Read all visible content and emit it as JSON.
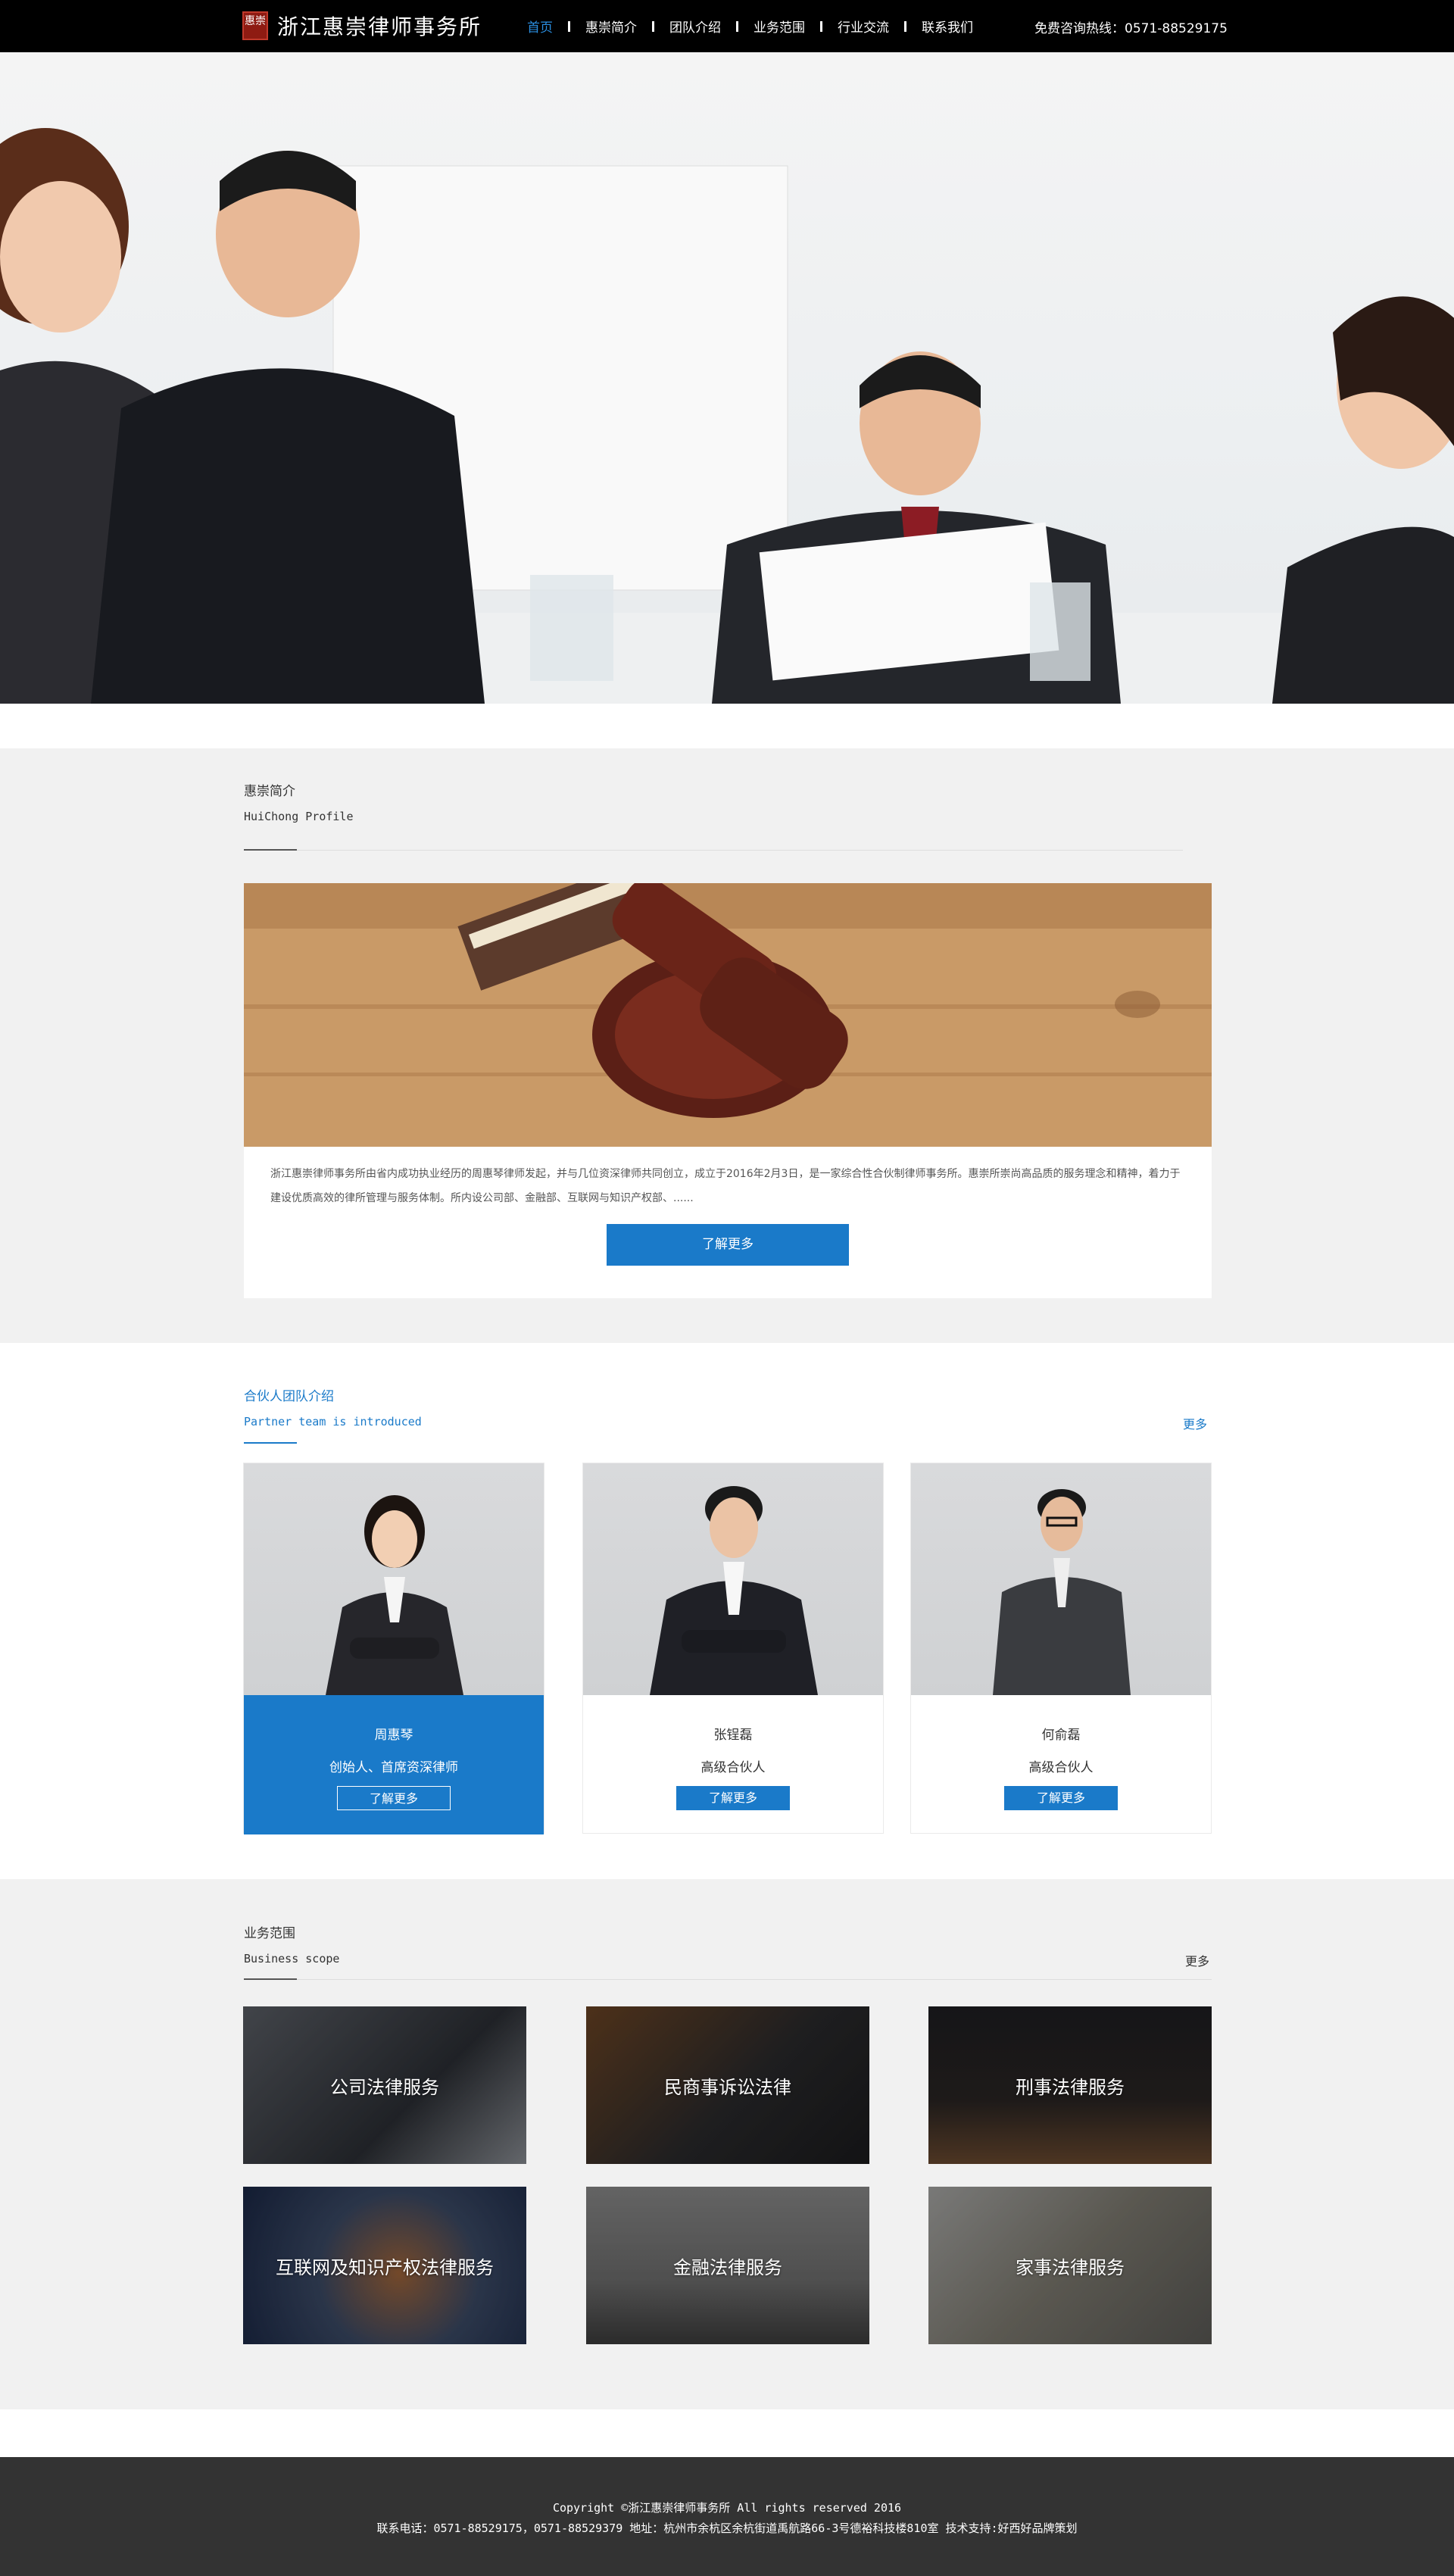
{
  "header": {
    "logo_seal": "惠崇",
    "logo_text": "浙江惠崇律师事务所",
    "nav": [
      "首页",
      "惠崇简介",
      "团队介绍",
      "业务范围",
      "行业交流",
      "联系我们"
    ],
    "hotline": "免费咨询热线：0571-88529175"
  },
  "profile": {
    "title": "惠崇简介",
    "subtitle": "HuiChong Profile",
    "text": "浙江惠崇律师事务所由省内成功执业经历的周惠琴律师发起，并与几位资深律师共同创立，成立于2016年2月3日，是一家综合性合伙制律师事务所。惠崇所崇尚高品质的服务理念和精神，着力于建设优质高效的律所管理与服务体制。所内设公司部、金融部、互联网与知识产权部、......",
    "button": "了解更多"
  },
  "team": {
    "title": "合伙人团队介绍",
    "subtitle": "Partner team is introduced",
    "more": "更多",
    "members": [
      {
        "name": "周惠琴",
        "title": "创始人、首席资深律师",
        "button": "了解更多"
      },
      {
        "name": "张锃磊",
        "title": "高级合伙人",
        "button": "了解更多"
      },
      {
        "name": "何俞磊",
        "title": "高级合伙人",
        "button": "了解更多"
      }
    ]
  },
  "business": {
    "title": "业务范围",
    "subtitle": "Business scope",
    "more": "更多",
    "items": [
      "公司法律服务",
      "民商事诉讼法律",
      "刑事法律服务",
      "互联网及知识产权法律服务",
      "金融法律服务",
      "家事法律服务"
    ]
  },
  "footer": {
    "copyright": "Copyright ©浙江惠崇律师事务所 All rights reserved 2016",
    "contact": "联系电话：0571-88529175，0571-88529379 地址：杭州市余杭区余杭街道禹航路66-3号德裕科技楼810室 技术支持:好西好品牌策划"
  },
  "colors": {
    "accent": "#1a7ac9",
    "header_bg": "#000000",
    "section_bg": "#f1f1f1",
    "footer_bg": "#333333"
  }
}
